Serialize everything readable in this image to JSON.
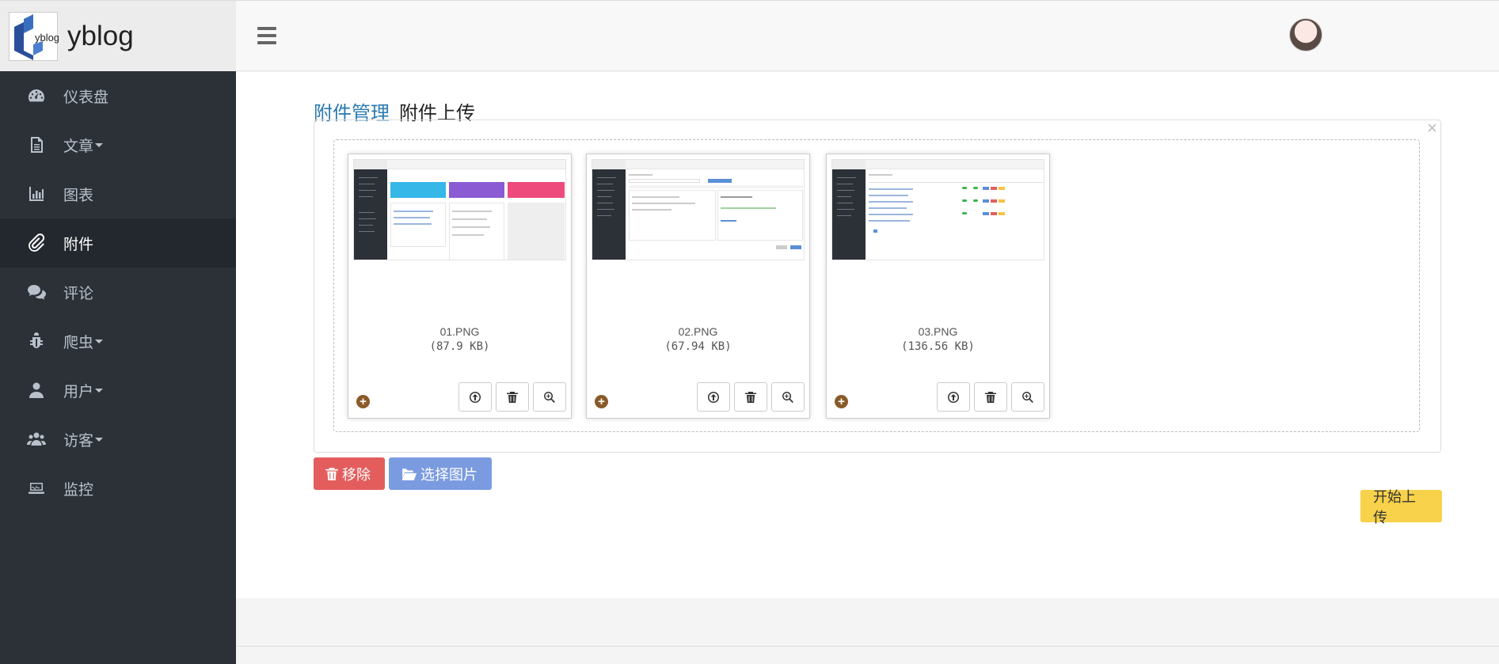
{
  "brand": {
    "name": "yblog",
    "logo_text": "yblog"
  },
  "sidebar": {
    "items": [
      {
        "label": "仪表盘",
        "icon": "dashboard-icon",
        "has_caret": false,
        "active": false
      },
      {
        "label": "文章",
        "icon": "file-text-icon",
        "has_caret": true,
        "active": false
      },
      {
        "label": "图表",
        "icon": "bar-chart-icon",
        "has_caret": false,
        "active": false
      },
      {
        "label": "附件",
        "icon": "paperclip-icon",
        "has_caret": false,
        "active": true
      },
      {
        "label": "评论",
        "icon": "comments-icon",
        "has_caret": false,
        "active": false
      },
      {
        "label": "爬虫",
        "icon": "bug-icon",
        "has_caret": true,
        "active": false
      },
      {
        "label": "用户",
        "icon": "user-icon",
        "has_caret": true,
        "active": false
      },
      {
        "label": "访客",
        "icon": "users-icon",
        "has_caret": true,
        "active": false
      },
      {
        "label": "监控",
        "icon": "laptop-icon",
        "has_caret": false,
        "active": false
      }
    ]
  },
  "breadcrumb": {
    "parent": "附件管理",
    "current": "附件上传"
  },
  "files": [
    {
      "name": "01.PNG",
      "size": "(87.9 KB)"
    },
    {
      "name": "02.PNG",
      "size": "(67.94 KB)"
    },
    {
      "name": "03.PNG",
      "size": "(136.56 KB)"
    }
  ],
  "buttons": {
    "remove": "移除",
    "select": "选择图片",
    "start": "开始上传",
    "close": "×"
  },
  "colors": {
    "sidebar_bg": "#2c3138",
    "link": "#2a7ab0",
    "remove": "#e45d5d",
    "select": "#7b9be0",
    "start": "#f7d24a"
  }
}
